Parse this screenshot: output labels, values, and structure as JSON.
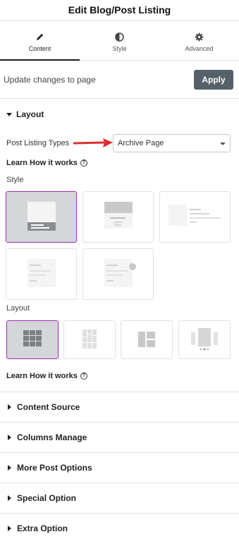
{
  "header": {
    "title": "Edit Blog/Post Listing"
  },
  "tabs": [
    {
      "label": "Content",
      "icon": "pencil-icon",
      "active": true
    },
    {
      "label": "Style",
      "icon": "half-circle-icon",
      "active": false
    },
    {
      "label": "Advanced",
      "icon": "gear-icon",
      "active": false
    }
  ],
  "update": {
    "text": "Update changes to page",
    "apply_label": "Apply"
  },
  "layout_section": {
    "title": "Layout",
    "post_listing_label": "Post Listing Types",
    "post_listing_value": "Archive Page",
    "learn_label": "Learn How it works",
    "style_label": "Style",
    "style_options": [
      {
        "name": "style-1",
        "selected": true
      },
      {
        "name": "style-2",
        "selected": false
      },
      {
        "name": "style-3",
        "selected": false
      },
      {
        "name": "style-4",
        "selected": false
      },
      {
        "name": "style-5",
        "selected": false
      }
    ],
    "layout_label": "Layout",
    "layout_options": [
      {
        "name": "grid",
        "selected": true
      },
      {
        "name": "masonry",
        "selected": false
      },
      {
        "name": "metro",
        "selected": false
      },
      {
        "name": "carousel",
        "selected": false
      }
    ],
    "learn_label_2": "Learn How it works"
  },
  "accordions": [
    {
      "label": "Content Source"
    },
    {
      "label": "Columns Manage"
    },
    {
      "label": "More Post Options"
    },
    {
      "label": "Special Option"
    },
    {
      "label": "Extra Option"
    }
  ],
  "colors": {
    "accent_selected": "#9b2bb6",
    "apply_bg": "#556068",
    "arrow": "#d8322f"
  }
}
